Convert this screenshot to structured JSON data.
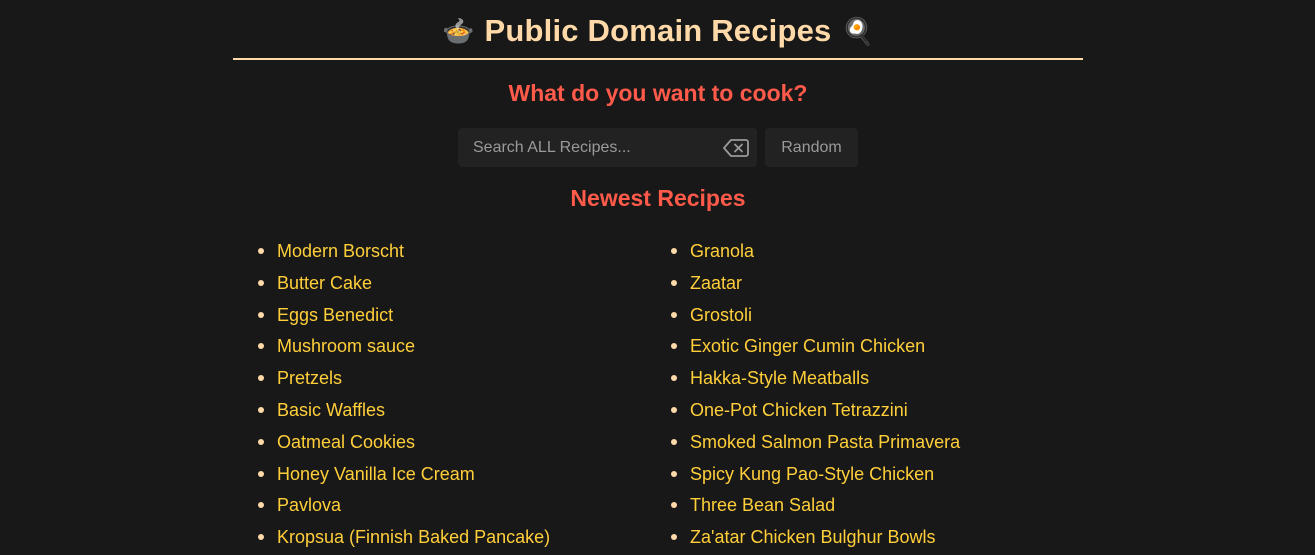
{
  "header": {
    "title": "Public Domain Recipes",
    "left_emoji": "🍲",
    "right_emoji": "🍳"
  },
  "prompt": "What do you want to cook?",
  "search": {
    "placeholder": "Search ALL Recipes...",
    "value": "",
    "clear_icon": "backspace-icon",
    "random_label": "Random"
  },
  "section_title": "Newest Recipes",
  "colors": {
    "background": "#181818",
    "title": "#ffd9a8",
    "accent": "#ff5a4a",
    "link": "#ffcf3a"
  },
  "recipes": {
    "left": [
      "Modern Borscht",
      "Butter Cake",
      "Eggs Benedict",
      "Mushroom sauce",
      "Pretzels",
      "Basic Waffles",
      "Oatmeal Cookies",
      "Honey Vanilla Ice Cream",
      "Pavlova",
      "Kropsua (Finnish Baked Pancake)"
    ],
    "right": [
      "Granola",
      "Zaatar",
      "Grostoli",
      "Exotic Ginger Cumin Chicken",
      "Hakka-Style Meatballs",
      "One-Pot Chicken Tetrazzini",
      "Smoked Salmon Pasta Primavera",
      "Spicy Kung Pao-Style Chicken",
      "Three Bean Salad",
      "Za'atar Chicken Bulghur Bowls"
    ]
  }
}
